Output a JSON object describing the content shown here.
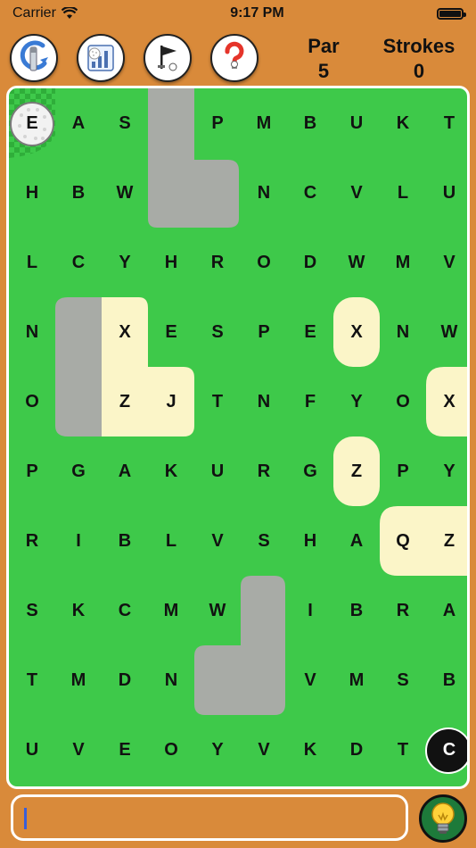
{
  "status": {
    "carrier": "Carrier",
    "time": "9:17 PM"
  },
  "toolbar": {
    "buttons": [
      {
        "icon": "golf-swing-icon"
      },
      {
        "icon": "stats-icon"
      },
      {
        "icon": "golf-flag-icon"
      },
      {
        "icon": "help-icon"
      }
    ],
    "par_label": "Par",
    "par_value": "5",
    "strokes_label": "Strokes",
    "strokes_value": "0"
  },
  "board": {
    "rows": [
      [
        "E",
        "A",
        "S",
        "",
        "P",
        "M",
        "B",
        "U",
        "K",
        "T"
      ],
      [
        "H",
        "B",
        "W",
        "",
        "",
        "N",
        "C",
        "V",
        "L",
        "U"
      ],
      [
        "L",
        "C",
        "Y",
        "H",
        "R",
        "O",
        "D",
        "W",
        "M",
        "V"
      ],
      [
        "N",
        "",
        "X",
        "E",
        "S",
        "P",
        "E",
        "X",
        "N",
        "W"
      ],
      [
        "O",
        "",
        "Z",
        "J",
        "T",
        "N",
        "F",
        "Y",
        "O",
        "X"
      ],
      [
        "P",
        "G",
        "A",
        "K",
        "U",
        "R",
        "G",
        "Z",
        "P",
        "Y"
      ],
      [
        "R",
        "I",
        "B",
        "L",
        "V",
        "S",
        "H",
        "A",
        "Q",
        "Z"
      ],
      [
        "S",
        "K",
        "C",
        "M",
        "W",
        "",
        "I",
        "B",
        "R",
        "A"
      ],
      [
        "T",
        "M",
        "D",
        "N",
        "",
        "",
        "V",
        "M",
        "S",
        "B"
      ],
      [
        "U",
        "V",
        "E",
        "O",
        "Y",
        "V",
        "K",
        "D",
        "T",
        "C"
      ]
    ],
    "ball_letter": "E",
    "hole_letter": "C",
    "colors": {
      "grass": "#3ec94a",
      "sand": "#fbf5c8",
      "rock": "#a8aba6",
      "tee": "#2fae3a"
    }
  },
  "input": {
    "placeholder": ""
  },
  "hint": {
    "icon": "lightbulb-icon"
  }
}
